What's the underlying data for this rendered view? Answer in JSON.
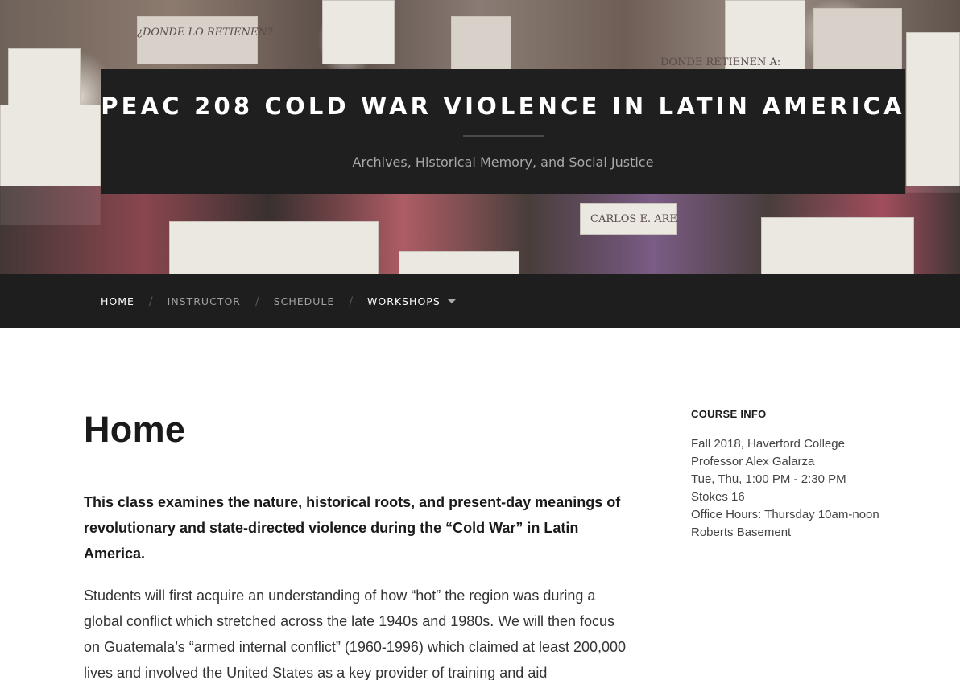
{
  "header": {
    "site_title": "PEAC 208 COLD WAR VIOLENCE IN LATIN AMERICA",
    "site_description": "Archives, Historical Memory, and Social Justice",
    "hero_sign_texts": [
      "¿DONDE LO RETIENEN?",
      "DONDE RETIENEN A:",
      "CARLOS E. ARE"
    ]
  },
  "nav": {
    "items": [
      {
        "label": "HOME",
        "active": true
      },
      {
        "label": "INSTRUCTOR",
        "active": false
      },
      {
        "label": "SCHEDULE",
        "active": false
      },
      {
        "label": "WORKSHOPS",
        "active": true,
        "has_dropdown": true
      }
    ],
    "separator": "/",
    "dropdown_icon": "caret-down-icon"
  },
  "main": {
    "page_title": "Home",
    "lead": "This class examines the nature, historical roots, and present-day meanings of revolutionary and state-directed violence during the “Cold War” in Latin America.",
    "body": "Students will first acquire an understanding of how “hot” the region was during a global conflict which stretched across the late 1940s and 1980s. We will then focus on Guatemala’s “armed internal conflict” (1960-1996) which claimed at least 200,000 lives and involved the United States as a key provider of training and aid"
  },
  "sidebar": {
    "widget_title": "COURSE INFO",
    "lines": [
      "Fall 2018, Haverford College",
      "Professor Alex Galarza",
      "Tue, Thu, 1:00 PM - 2:30 PM",
      "Stokes 16",
      "Office Hours: Thursday 10am-noon",
      "Roberts Basement"
    ]
  },
  "colors": {
    "header_box": "#1f1f1f",
    "navbar": "#1e1e1e",
    "nav_text_active": "#ffffff",
    "nav_text_dim": "#a0a0a0",
    "body_text": "#333333"
  }
}
